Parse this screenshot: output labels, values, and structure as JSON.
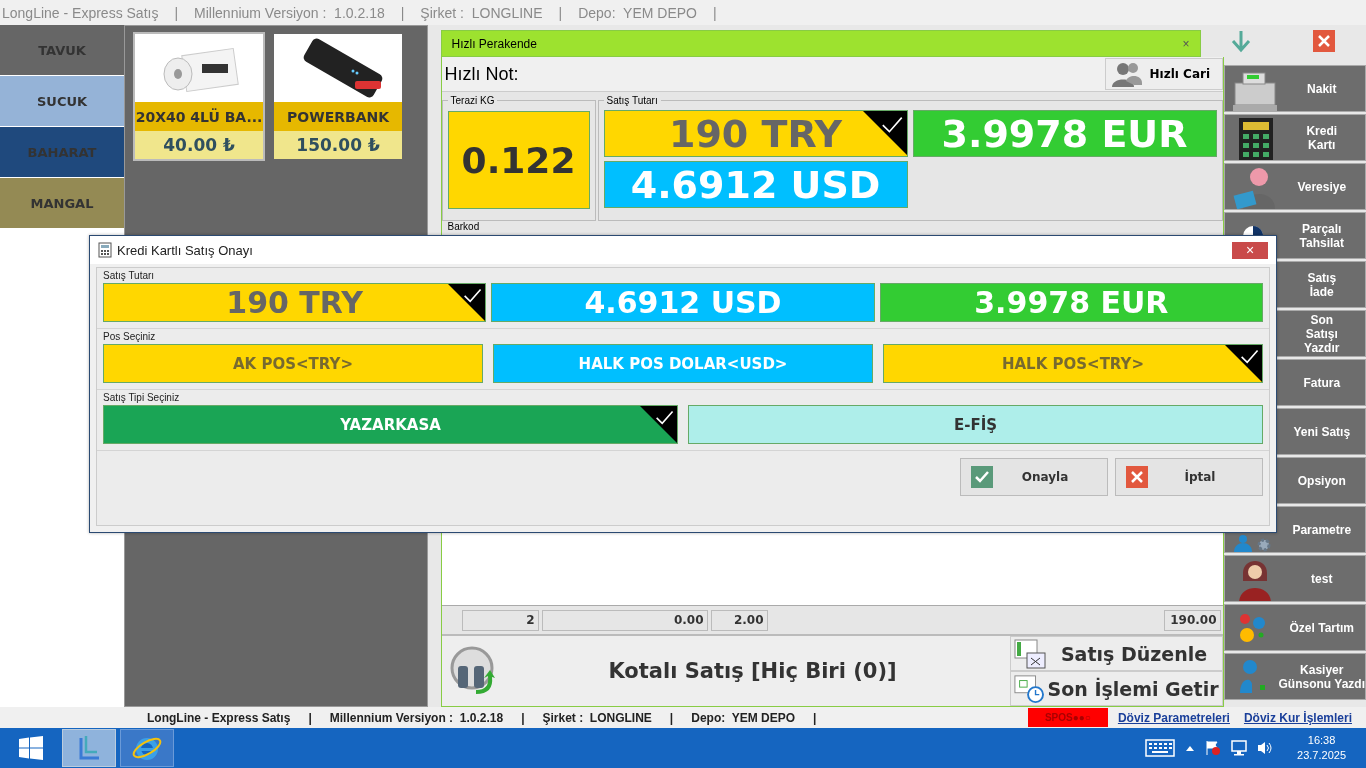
{
  "title_bar": {
    "segments": [
      "LongLine - Express Satış",
      "|",
      "Millennium Versiyon :  1.0.2.18",
      "|",
      "Şirket :  LONGLINE",
      "|",
      "Depo:  YEM DEPO",
      "|"
    ]
  },
  "categories": [
    {
      "label": "TAVUK",
      "color": "#666666"
    },
    {
      "label": "SUCUK",
      "color": "#95b3d7"
    },
    {
      "label": "BAHARAT",
      "color": "#1f497d"
    },
    {
      "label": "MANGAL",
      "color": "#948a54"
    }
  ],
  "products": [
    {
      "name": "20X40 4LÜ BA...",
      "price": "40.00 ₺",
      "selected": true
    },
    {
      "name": "POWERBANK",
      "price": "150.00 ₺",
      "selected": false
    }
  ],
  "sale_tab": {
    "title": "Hızlı Perakende",
    "close": "×"
  },
  "quick_note": {
    "label": "Hızlı Not:"
  },
  "quick_customer_button": "Hızlı Cari",
  "scale": {
    "label": "Terazi KG",
    "value": "0.122"
  },
  "sale_total": {
    "label": "Satış Tutarı",
    "amounts": [
      {
        "text": "190 TRY",
        "color": "#ffd700",
        "selected": true
      },
      {
        "text": "3.9978 EUR",
        "color": "#33cc33",
        "selected": false
      },
      {
        "text": "4.6912 USD",
        "color": "#00bfff",
        "selected": false
      }
    ]
  },
  "barcode": {
    "label": "Barkod"
  },
  "totals_row": [
    "2",
    "0.00",
    "2.00",
    "190.00"
  ],
  "quota_sale": "Kotalı Satış [Hiç Biri (0)]",
  "edit_sale_button": "Satış Düzenle",
  "last_transaction_button": "Son İşlemi Getir",
  "sidebar": {
    "items": [
      "Nakit",
      "Kredi\nKartı",
      "Veresiye",
      "Parçalı\nTahsilat",
      "Satış\nİade",
      "Son\nSatışı\nYazdır",
      "Fatura",
      "Yeni Satış",
      "Opsiyon",
      "Parametre",
      "test",
      "Özel Tartım",
      "Kasiyer\nGünsonu Yazdı"
    ]
  },
  "dialog": {
    "title": "Kredi Kartlı Satış Onayı",
    "close": "×",
    "amount_label": "Satış Tutarı",
    "amounts": [
      {
        "text": "190 TRY",
        "color": "#ffd700",
        "selected": true
      },
      {
        "text": "4.6912 USD",
        "color": "#00bfff",
        "selected": false
      },
      {
        "text": "3.9978 EUR",
        "color": "#33cc33",
        "selected": false
      }
    ],
    "pos_label": "Pos Seçiniz",
    "pos_options": [
      {
        "text": "AK POS<TRY>",
        "color": "#ffd700",
        "selected": false
      },
      {
        "text": "HALK POS DOLAR<USD>",
        "color": "#00bfff",
        "selected": false
      },
      {
        "text": "HALK POS<TRY>",
        "color": "#ffd700",
        "selected": true
      }
    ],
    "type_label": "Satış Tipi Seçiniz",
    "sale_types": [
      {
        "text": "YAZARKASA",
        "color": "#1aa555",
        "selected": true
      },
      {
        "text": "E-FİŞ",
        "color": "#aeeeea",
        "selected": false
      }
    ],
    "buttons": [
      {
        "label": "Onayla",
        "kind": "confirm"
      },
      {
        "label": "İptal",
        "kind": "cancel"
      }
    ]
  },
  "status_bar": {
    "info": [
      "LongLine - Express Satış",
      "|",
      "Millennium Versiyon :  1.0.2.18",
      "|",
      "Şirket :  LONGLINE",
      "|",
      "Depo:  YEM DEPO",
      "|"
    ],
    "spos": "SPOS●●○",
    "links": [
      "Döviz Parametreleri",
      "Döviz Kur İşlemleri"
    ]
  },
  "taskbar": {
    "apps": [
      {
        "selected": true
      },
      {
        "selected": false
      }
    ],
    "time": "16:38",
    "date": "23.7.2025"
  }
}
